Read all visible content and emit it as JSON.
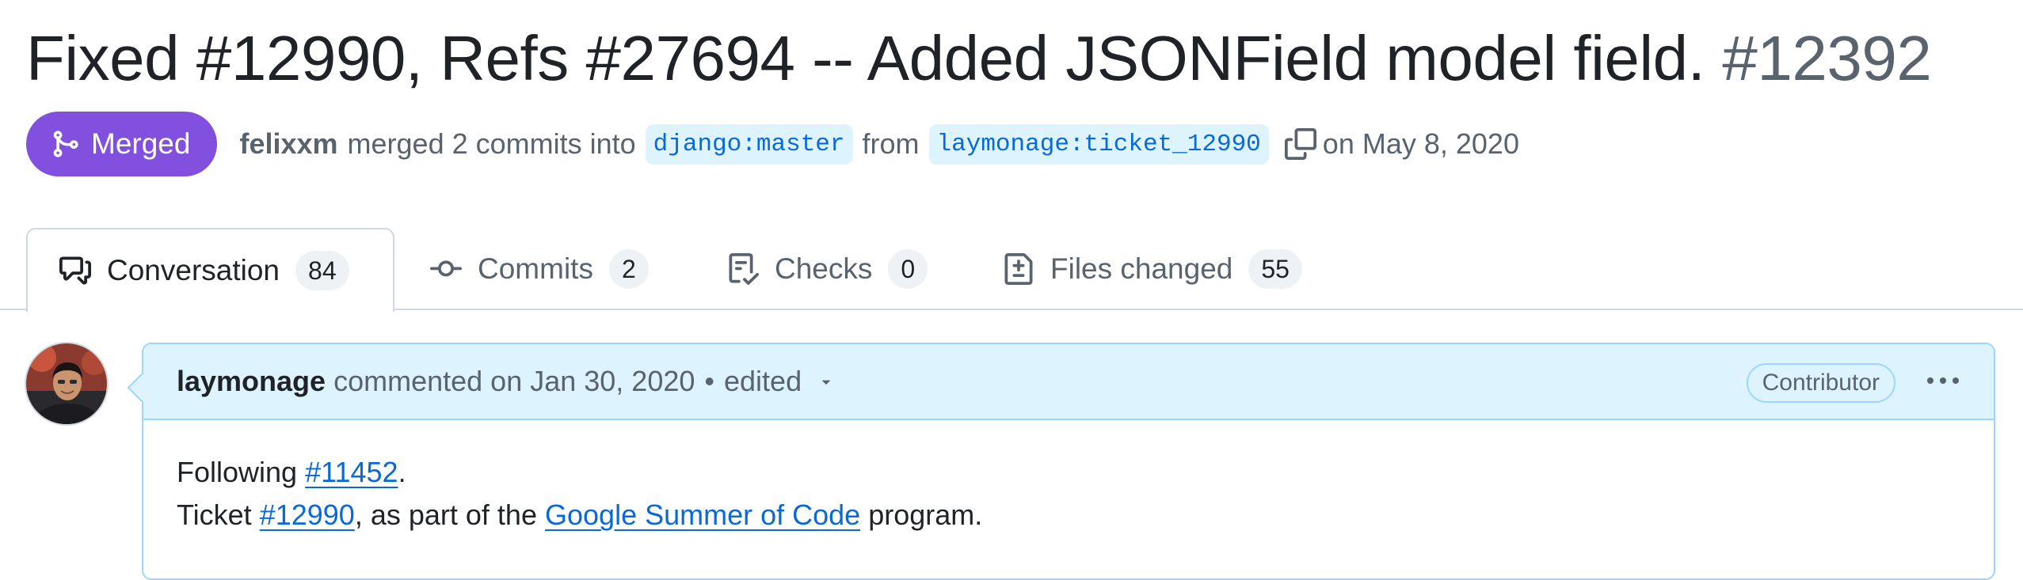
{
  "pr": {
    "title": "Fixed #12990, Refs #27694 -- Added JSONField model field.",
    "number": "#12392"
  },
  "meta": {
    "state": "Merged",
    "author": "felixxm",
    "merged_text": "merged 2 commits into",
    "base_branch": "django:master",
    "from_text": "from",
    "head_branch": "laymonage:ticket_12990",
    "date_text": "on May 8, 2020",
    "state_color": "#8250df"
  },
  "tabs": [
    {
      "label": "Conversation",
      "count": "84",
      "icon": "comment-discussion-icon"
    },
    {
      "label": "Commits",
      "count": "2",
      "icon": "git-commit-icon"
    },
    {
      "label": "Checks",
      "count": "0",
      "icon": "checklist-icon"
    },
    {
      "label": "Files changed",
      "count": "55",
      "icon": "file-diff-icon"
    }
  ],
  "comment": {
    "author": "laymonage",
    "action": "commented on Jan 30, 2020",
    "separator": "•",
    "edited": "edited",
    "role_badge": "Contributor",
    "body": {
      "line1_prefix": "Following",
      "line1_link": "#11452",
      "line1_suffix": ".",
      "line2_prefix": "Ticket",
      "line2_link1": "#12990",
      "line2_middle": ", as part of the",
      "line2_link2": "Google Summer of Code",
      "line2_suffix": "program."
    }
  },
  "colors": {
    "link": "#0969da",
    "header_bg": "#ddf4ff",
    "header_border": "#9cd6ff"
  }
}
